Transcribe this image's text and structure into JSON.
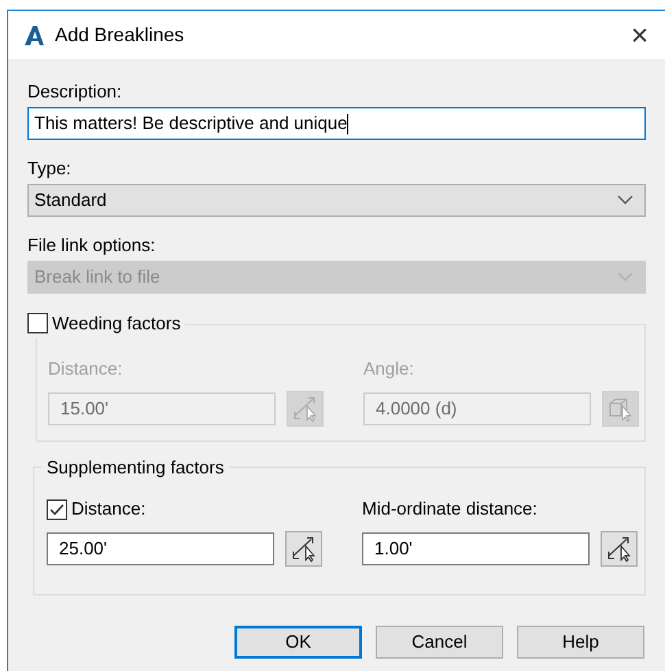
{
  "window": {
    "title": "Add Breaklines",
    "close": "×"
  },
  "description": {
    "label": "Description:",
    "value": "This matters! Be descriptive and unique",
    "focused": true
  },
  "type": {
    "label": "Type:",
    "value": "Standard",
    "disabled": false
  },
  "file_link": {
    "label": "File link options:",
    "value": "Break link to file",
    "disabled": true
  },
  "weeding": {
    "label": "Weeding factors",
    "checked": false,
    "fields": [
      {
        "label": "Distance:",
        "value": "15.00'",
        "disabled": true
      },
      {
        "label": "Angle:",
        "value": "4.0000 (d)",
        "disabled": true
      }
    ]
  },
  "supplementing": {
    "label": "Supplementing factors",
    "fields": [
      {
        "label": "Distance:",
        "value": "25.00'",
        "disabled": false,
        "kind": "checkbox",
        "checked": true
      },
      {
        "label": "Mid-ordinate distance:",
        "value": "1.00'",
        "disabled": false,
        "kind": "label"
      }
    ]
  },
  "buttons": [
    {
      "label": "OK",
      "default": true
    },
    {
      "label": "Cancel",
      "default": false
    },
    {
      "label": "Help",
      "default": false
    }
  ]
}
